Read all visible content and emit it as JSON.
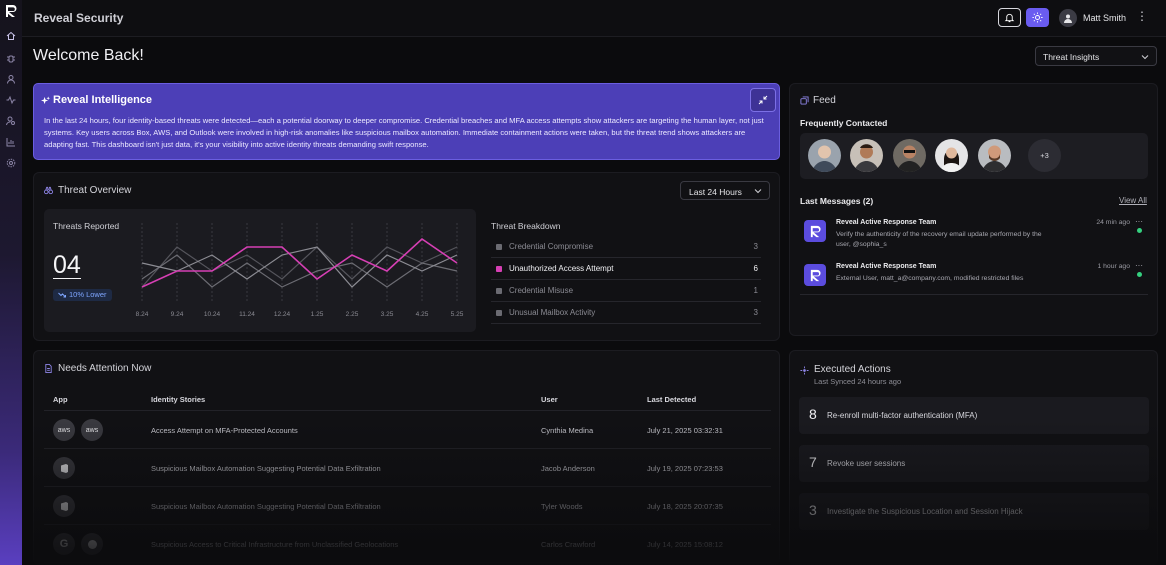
{
  "app": {
    "name": "Reveal Security"
  },
  "user": {
    "name": "Matt Smith"
  },
  "welcome": "Welcome Back!",
  "view_select": {
    "value": "Threat Insights"
  },
  "intelligence": {
    "title": "Reveal Intelligence",
    "body": "In the last 24 hours, four identity-based threats were detected—each a potential doorway to deeper compromise. Credential breaches and MFA access attempts show attackers are targeting the human layer, not just systems. Key users across Box, AWS, and Outlook were involved in high-risk anomalies like suspicious mailbox automation. Immediate containment actions were taken, but the threat trend shows attackers are adapting fast. This dashboard isn't just data, it's your visibility into active identity threats demanding swift response."
  },
  "threat_overview": {
    "title": "Threat Overview",
    "range": "Last 24 Hours",
    "reported_label": "Threats Reported",
    "reported_value": "04",
    "trend": "10% Lower",
    "breakdown_title": "Threat Breakdown",
    "breakdown": [
      {
        "name": "Credential Compromise",
        "count": "3",
        "color": "#6b6b72",
        "active": false
      },
      {
        "name": "Unauthorized Access Attempt",
        "count": "6",
        "color": "#d63fb4",
        "active": true
      },
      {
        "name": "Credential Misuse",
        "count": "1",
        "color": "#6b6b72",
        "active": false
      },
      {
        "name": "Unusual Mailbox Activity",
        "count": "3",
        "color": "#6b6b72",
        "active": false
      }
    ]
  },
  "chart_data": {
    "type": "line",
    "categories": [
      "8.24",
      "9.24",
      "10.24",
      "11.24",
      "12.24",
      "1.25",
      "2.25",
      "3.25",
      "4.25",
      "5.25"
    ],
    "ylim": [
      0,
      10
    ],
    "grid": false,
    "series": [
      {
        "color": "#d63fb4",
        "values": [
          2,
          4,
          4,
          7,
          7,
          3,
          6,
          4,
          8,
          5
        ]
      },
      {
        "color": "#8c8c93",
        "values": [
          5,
          4,
          6,
          3,
          6,
          7,
          2,
          6,
          4,
          6
        ]
      },
      {
        "color": "#6c6c73",
        "values": [
          3,
          6,
          2,
          5,
          2,
          4,
          5,
          2,
          5,
          4
        ]
      },
      {
        "color": "#55555c",
        "values": [
          2,
          7,
          4,
          6,
          3,
          7,
          3,
          7,
          5,
          7
        ]
      }
    ]
  },
  "feed": {
    "title": "Feed",
    "frequently_contacted": "Frequently Contacted",
    "more": "+3",
    "last_messages": "Last Messages (2)",
    "view_all": "View All",
    "messages": [
      {
        "from": "Reveal Active Response Team",
        "text": "Verify the authenticity of the recovery email update performed by the user, @sophia_s",
        "time": "24 min ago"
      },
      {
        "from": "Reveal Active Response Team",
        "text": "External User, matt_a@company.com, modified restricted files",
        "time": "1 hour ago"
      }
    ]
  },
  "needs_attention": {
    "title": "Needs Attention Now",
    "headers": [
      "App",
      "Identity Stories",
      "User",
      "Last Detected"
    ],
    "rows": [
      {
        "apps": [
          "aws",
          "aws"
        ],
        "story": "Access Attempt on MFA-Protected Accounts",
        "user": "Cynthia Medina",
        "detected": "July 21, 2025 03:32:31"
      },
      {
        "apps": [
          "office-icon"
        ],
        "story": "Suspicious Mailbox Automation Suggesting Potential Data Exfiltration",
        "user": "Jacob Anderson",
        "detected": "July 19, 2025 07:23:53"
      },
      {
        "apps": [
          "office-icon"
        ],
        "story": "Suspicious Mailbox Automation Suggesting Potential Data Exfiltration",
        "user": "Tyler Woods",
        "detected": "July 18, 2025 20:07:35"
      },
      {
        "apps": [
          "google-icon",
          "github-icon"
        ],
        "story": "Suspicious Access to Critical Infrastructure from Unclassified Geolocations",
        "user": "Carlos Crawford",
        "detected": "July 14, 2025 15:08:12"
      }
    ]
  },
  "executed_actions": {
    "title": "Executed Actions",
    "subtitle": "Last Synced 24 hours ago",
    "items": [
      {
        "n": "8",
        "text": "Re-enroll multi-factor authentication (MFA)"
      },
      {
        "n": "7",
        "text": "Revoke user sessions"
      },
      {
        "n": "3",
        "text": "Investigate the Suspicious Location and Session Hijack"
      }
    ]
  }
}
